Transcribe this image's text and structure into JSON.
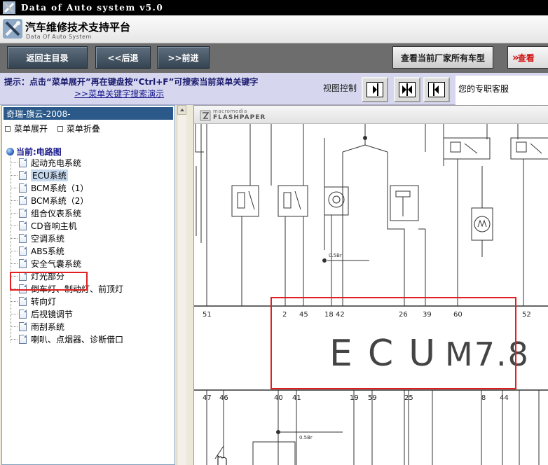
{
  "window": {
    "title": "Data of Auto system v5.0"
  },
  "header": {
    "title": "汽车维修技术支持平台",
    "subtitle": "Data Of Auto System"
  },
  "toolbar": {
    "back_main": "返回主目录",
    "back": "<<后退",
    "forward": ">>前进",
    "view_all_models": "查看当前厂家所有车型",
    "view_more": "查看"
  },
  "hint": {
    "line1": "提示：点击“菜单展开”再在键盘按“Ctrl+F”可搜索当前菜单关键字",
    "line2": ">>菜单关键字搜索演示"
  },
  "view_control": {
    "label": "视图控制"
  },
  "service": {
    "label": "您的专职客服"
  },
  "tree": {
    "vehicle": "奇瑞-旗云-2008-",
    "expand": "菜单展开",
    "collapse": "菜单折叠",
    "current": "当前:电路图",
    "items": [
      "起动充电系统",
      "ECU系统",
      "BCM系统（1）",
      "BCM系统（2）",
      "组合仪表系统",
      "CD音响主机",
      "空调系统",
      "ABS系统",
      "安全气囊系统",
      "灯光部分",
      "倒车灯、制动灯、前顶灯",
      "转向灯",
      "后视镜调节",
      "雨刮系统",
      "喇叭、点烟器、诊断借口"
    ],
    "selected_index": 1
  },
  "viewer": {
    "brand_line1": "macromedia",
    "brand_line2": "FLASHPAPER"
  },
  "diagram": {
    "ecu_label": "ECU",
    "ecu_model": "M7.8",
    "top_pins": [
      "51",
      "2",
      "45",
      "18",
      "42",
      "26",
      "39",
      "60",
      "52"
    ],
    "bottom_pins": [
      "47",
      "46",
      "40",
      "41",
      "19",
      "59",
      "25",
      "8",
      "44"
    ],
    "wire_labels": [
      "0.5Br",
      "0.5Br"
    ]
  },
  "colors": {
    "highlight_box": "#e02020",
    "vehicle_bar": "#2b5a8a",
    "title_bar": "#000000"
  }
}
